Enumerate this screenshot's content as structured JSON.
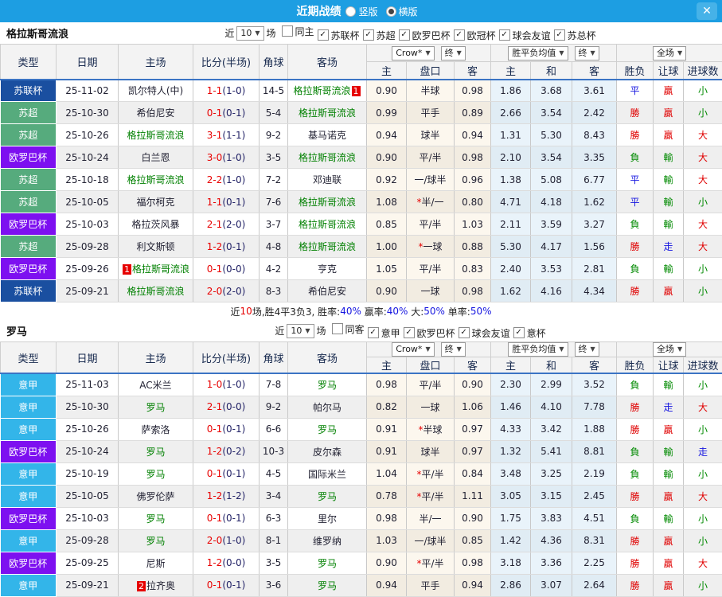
{
  "titlebar": {
    "title": "近期战绩",
    "layout_options": [
      {
        "label": "竖版",
        "selected": false
      },
      {
        "label": "横版",
        "selected": true
      }
    ],
    "close_label": "✕"
  },
  "header_labels": {
    "type": "类型",
    "date": "日期",
    "home": "主场",
    "score": "比分(半场)",
    "corner": "角球",
    "away": "客场",
    "bookmaker_select": "Crow*",
    "final_select": "终",
    "mean_select": "胜平负均值",
    "final_select2": "终",
    "scope_select": "全场",
    "odds_home": "主",
    "odds_handicap": "盘口",
    "odds_away": "客",
    "mean_home": "主",
    "mean_draw": "和",
    "mean_away": "客",
    "result": "胜负",
    "handicap_result": "让球",
    "goals": "进球数"
  },
  "league_colors": {
    "苏联杯": "#1A4FA0",
    "苏超": "#56AB7D",
    "欧罗巴杯": "#7D10F0",
    "意甲": "#33B5E9"
  },
  "result_colors": {
    "勝": "#E00000",
    "平": "#1515E0",
    "負": "#018A01",
    "贏": "#E00000",
    "輸": "#018A01",
    "走": "#1515E0",
    "大": "#E00000",
    "小": "#018A01"
  },
  "sections": [
    {
      "team": "格拉斯哥流浪",
      "filter": {
        "near": "近",
        "count": "10",
        "matches": "场",
        "same": {
          "label": "同主",
          "checked": false
        },
        "leagues": [
          {
            "label": "苏联杯",
            "checked": true
          },
          {
            "label": "苏超",
            "checked": true
          },
          {
            "label": "欧罗巴杯",
            "checked": true
          },
          {
            "label": "欧冠杯",
            "checked": true
          },
          {
            "label": "球会友谊",
            "checked": true
          },
          {
            "label": "苏总杯",
            "checked": true
          }
        ]
      },
      "rows": [
        {
          "league": "苏联杯",
          "date": "25-11-02",
          "home": "凯尔特人(中)",
          "home_hl": false,
          "home_badge": null,
          "score_ft": "1-1",
          "score_ht": "1-0",
          "corner": "14-5",
          "away": "格拉斯哥流浪",
          "away_hl": true,
          "away_badge": "1",
          "crow_home": "0.90",
          "handicap": "半球",
          "crow_away": "0.98",
          "mean_home": "1.86",
          "mean_draw": "3.68",
          "mean_away": "3.61",
          "result": "平",
          "let": "贏",
          "goals": "小"
        },
        {
          "league": "苏超",
          "date": "25-10-30",
          "home": "希伯尼安",
          "home_hl": false,
          "home_badge": null,
          "score_ft": "0-1",
          "score_ht": "0-1",
          "corner": "5-4",
          "away": "格拉斯哥流浪",
          "away_hl": true,
          "away_badge": null,
          "crow_home": "0.99",
          "handicap": "平手",
          "crow_away": "0.89",
          "mean_home": "2.66",
          "mean_draw": "3.54",
          "mean_away": "2.42",
          "result": "勝",
          "let": "贏",
          "goals": "小"
        },
        {
          "league": "苏超",
          "date": "25-10-26",
          "home": "格拉斯哥流浪",
          "home_hl": true,
          "home_badge": null,
          "score_ft": "3-1",
          "score_ht": "1-1",
          "corner": "9-2",
          "away": "基马诺克",
          "away_hl": false,
          "away_badge": null,
          "crow_home": "0.94",
          "handicap": "球半",
          "crow_away": "0.94",
          "mean_home": "1.31",
          "mean_draw": "5.30",
          "mean_away": "8.43",
          "result": "勝",
          "let": "贏",
          "goals": "大"
        },
        {
          "league": "欧罗巴杯",
          "date": "25-10-24",
          "home": "白兰恩",
          "home_hl": false,
          "home_badge": null,
          "score_ft": "3-0",
          "score_ht": "1-0",
          "corner": "3-5",
          "away": "格拉斯哥流浪",
          "away_hl": true,
          "away_badge": null,
          "crow_home": "0.90",
          "handicap": "平/半",
          "crow_away": "0.98",
          "mean_home": "2.10",
          "mean_draw": "3.54",
          "mean_away": "3.35",
          "result": "負",
          "let": "輸",
          "goals": "大"
        },
        {
          "league": "苏超",
          "date": "25-10-18",
          "home": "格拉斯哥流浪",
          "home_hl": true,
          "home_badge": null,
          "score_ft": "2-2",
          "score_ht": "1-0",
          "corner": "7-2",
          "away": "邓迪联",
          "away_hl": false,
          "away_badge": null,
          "crow_home": "0.92",
          "handicap": "一/球半",
          "crow_away": "0.96",
          "mean_home": "1.38",
          "mean_draw": "5.08",
          "mean_away": "6.77",
          "result": "平",
          "let": "輸",
          "goals": "大"
        },
        {
          "league": "苏超",
          "date": "25-10-05",
          "home": "福尔柯克",
          "home_hl": false,
          "home_badge": null,
          "score_ft": "1-1",
          "score_ht": "0-1",
          "corner": "7-6",
          "away": "格拉斯哥流浪",
          "away_hl": true,
          "away_badge": null,
          "crow_home": "1.08",
          "handicap": "*半/一",
          "crow_away": "0.80",
          "mean_home": "4.71",
          "mean_draw": "4.18",
          "mean_away": "1.62",
          "result": "平",
          "let": "輸",
          "goals": "小"
        },
        {
          "league": "欧罗巴杯",
          "date": "25-10-03",
          "home": "格拉茨风暴",
          "home_hl": false,
          "home_badge": null,
          "score_ft": "2-1",
          "score_ht": "2-0",
          "corner": "3-7",
          "away": "格拉斯哥流浪",
          "away_hl": true,
          "away_badge": null,
          "crow_home": "0.85",
          "handicap": "平/半",
          "crow_away": "1.03",
          "mean_home": "2.11",
          "mean_draw": "3.59",
          "mean_away": "3.27",
          "result": "負",
          "let": "輸",
          "goals": "大"
        },
        {
          "league": "苏超",
          "date": "25-09-28",
          "home": "利文斯顿",
          "home_hl": false,
          "home_badge": null,
          "score_ft": "1-2",
          "score_ht": "0-1",
          "corner": "4-8",
          "away": "格拉斯哥流浪",
          "away_hl": true,
          "away_badge": null,
          "crow_home": "1.00",
          "handicap": "*一球",
          "crow_away": "0.88",
          "mean_home": "5.30",
          "mean_draw": "4.17",
          "mean_away": "1.56",
          "result": "勝",
          "let": "走",
          "goals": "大"
        },
        {
          "league": "欧罗巴杯",
          "date": "25-09-26",
          "home": "格拉斯哥流浪",
          "home_hl": true,
          "home_badge": "1",
          "score_ft": "0-1",
          "score_ht": "0-0",
          "corner": "4-2",
          "away": "亨克",
          "away_hl": false,
          "away_badge": null,
          "crow_home": "1.05",
          "handicap": "平/半",
          "crow_away": "0.83",
          "mean_home": "2.40",
          "mean_draw": "3.53",
          "mean_away": "2.81",
          "result": "負",
          "let": "輸",
          "goals": "小"
        },
        {
          "league": "苏联杯",
          "date": "25-09-21",
          "home": "格拉斯哥流浪",
          "home_hl": true,
          "home_badge": null,
          "score_ft": "2-0",
          "score_ht": "2-0",
          "corner": "8-3",
          "away": "希伯尼安",
          "away_hl": false,
          "away_badge": null,
          "crow_home": "0.90",
          "handicap": "一球",
          "crow_away": "0.98",
          "mean_home": "1.62",
          "mean_draw": "4.16",
          "mean_away": "4.34",
          "result": "勝",
          "let": "贏",
          "goals": "小"
        }
      ],
      "summary_parts": [
        {
          "text": "近",
          "color": "#222222"
        },
        {
          "text": "10",
          "color": "#E60000"
        },
        {
          "text": "场,胜4平3负3, 胜率:",
          "color": "#222222"
        },
        {
          "text": "40%",
          "color": "#1515E0"
        },
        {
          "text": " 赢率:",
          "color": "#222222"
        },
        {
          "text": "40%",
          "color": "#1515E0"
        },
        {
          "text": " 大:",
          "color": "#222222"
        },
        {
          "text": "50%",
          "color": "#1515E0"
        },
        {
          "text": " 单率:",
          "color": "#222222"
        },
        {
          "text": "50%",
          "color": "#1515E0"
        }
      ]
    },
    {
      "team": "罗马",
      "filter": {
        "near": "近",
        "count": "10",
        "matches": "场",
        "same": {
          "label": "同客",
          "checked": false
        },
        "leagues": [
          {
            "label": "意甲",
            "checked": true
          },
          {
            "label": "欧罗巴杯",
            "checked": true
          },
          {
            "label": "球会友谊",
            "checked": true
          },
          {
            "label": "意杯",
            "checked": true
          }
        ]
      },
      "rows": [
        {
          "league": "意甲",
          "date": "25-11-03",
          "home": "AC米兰",
          "home_hl": false,
          "home_badge": null,
          "score_ft": "1-0",
          "score_ht": "1-0",
          "corner": "7-8",
          "away": "罗马",
          "away_hl": true,
          "away_badge": null,
          "crow_home": "0.98",
          "handicap": "平/半",
          "crow_away": "0.90",
          "mean_home": "2.30",
          "mean_draw": "2.99",
          "mean_away": "3.52",
          "result": "負",
          "let": "輸",
          "goals": "小"
        },
        {
          "league": "意甲",
          "date": "25-10-30",
          "home": "罗马",
          "home_hl": true,
          "home_badge": null,
          "score_ft": "2-1",
          "score_ht": "0-0",
          "corner": "9-2",
          "away": "帕尔马",
          "away_hl": false,
          "away_badge": null,
          "crow_home": "0.82",
          "handicap": "一球",
          "crow_away": "1.06",
          "mean_home": "1.46",
          "mean_draw": "4.10",
          "mean_away": "7.78",
          "result": "勝",
          "let": "走",
          "goals": "大"
        },
        {
          "league": "意甲",
          "date": "25-10-26",
          "home": "萨索洛",
          "home_hl": false,
          "home_badge": null,
          "score_ft": "0-1",
          "score_ht": "0-1",
          "corner": "6-6",
          "away": "罗马",
          "away_hl": true,
          "away_badge": null,
          "crow_home": "0.91",
          "handicap": "*半球",
          "crow_away": "0.97",
          "mean_home": "4.33",
          "mean_draw": "3.42",
          "mean_away": "1.88",
          "result": "勝",
          "let": "贏",
          "goals": "小"
        },
        {
          "league": "欧罗巴杯",
          "date": "25-10-24",
          "home": "罗马",
          "home_hl": true,
          "home_badge": null,
          "score_ft": "1-2",
          "score_ht": "0-2",
          "corner": "10-3",
          "away": "皮尔森",
          "away_hl": false,
          "away_badge": null,
          "crow_home": "0.91",
          "handicap": "球半",
          "crow_away": "0.97",
          "mean_home": "1.32",
          "mean_draw": "5.41",
          "mean_away": "8.81",
          "result": "負",
          "let": "輸",
          "goals": "走"
        },
        {
          "league": "意甲",
          "date": "25-10-19",
          "home": "罗马",
          "home_hl": true,
          "home_badge": null,
          "score_ft": "0-1",
          "score_ht": "0-1",
          "corner": "4-5",
          "away": "国际米兰",
          "away_hl": false,
          "away_badge": null,
          "crow_home": "1.04",
          "handicap": "*平/半",
          "crow_away": "0.84",
          "mean_home": "3.48",
          "mean_draw": "3.25",
          "mean_away": "2.19",
          "result": "負",
          "let": "輸",
          "goals": "小"
        },
        {
          "league": "意甲",
          "date": "25-10-05",
          "home": "佛罗伦萨",
          "home_hl": false,
          "home_badge": null,
          "score_ft": "1-2",
          "score_ht": "1-2",
          "corner": "3-4",
          "away": "罗马",
          "away_hl": true,
          "away_badge": null,
          "crow_home": "0.78",
          "handicap": "*平/半",
          "crow_away": "1.11",
          "mean_home": "3.05",
          "mean_draw": "3.15",
          "mean_away": "2.45",
          "result": "勝",
          "let": "贏",
          "goals": "大"
        },
        {
          "league": "欧罗巴杯",
          "date": "25-10-03",
          "home": "罗马",
          "home_hl": true,
          "home_badge": null,
          "score_ft": "0-1",
          "score_ht": "0-1",
          "corner": "6-3",
          "away": "里尔",
          "away_hl": false,
          "away_badge": null,
          "crow_home": "0.98",
          "handicap": "半/一",
          "crow_away": "0.90",
          "mean_home": "1.75",
          "mean_draw": "3.83",
          "mean_away": "4.51",
          "result": "負",
          "let": "輸",
          "goals": "小"
        },
        {
          "league": "意甲",
          "date": "25-09-28",
          "home": "罗马",
          "home_hl": true,
          "home_badge": null,
          "score_ft": "2-0",
          "score_ht": "1-0",
          "corner": "8-1",
          "away": "维罗纳",
          "away_hl": false,
          "away_badge": null,
          "crow_home": "1.03",
          "handicap": "一/球半",
          "crow_away": "0.85",
          "mean_home": "1.42",
          "mean_draw": "4.36",
          "mean_away": "8.31",
          "result": "勝",
          "let": "贏",
          "goals": "小"
        },
        {
          "league": "欧罗巴杯",
          "date": "25-09-25",
          "home": "尼斯",
          "home_hl": false,
          "home_badge": null,
          "score_ft": "1-2",
          "score_ht": "0-0",
          "corner": "3-5",
          "away": "罗马",
          "away_hl": true,
          "away_badge": null,
          "crow_home": "0.90",
          "handicap": "*平/半",
          "crow_away": "0.98",
          "mean_home": "3.18",
          "mean_draw": "3.36",
          "mean_away": "2.25",
          "result": "勝",
          "let": "贏",
          "goals": "大"
        },
        {
          "league": "意甲",
          "date": "25-09-21",
          "home": "拉齐奥",
          "home_hl": false,
          "home_badge": "2",
          "score_ft": "0-1",
          "score_ht": "0-1",
          "corner": "3-6",
          "away": "罗马",
          "away_hl": true,
          "away_badge": null,
          "crow_home": "0.94",
          "handicap": "平手",
          "crow_away": "0.94",
          "mean_home": "2.86",
          "mean_draw": "3.07",
          "mean_away": "2.64",
          "result": "勝",
          "let": "贏",
          "goals": "小"
        }
      ],
      "summary_parts": []
    }
  ]
}
